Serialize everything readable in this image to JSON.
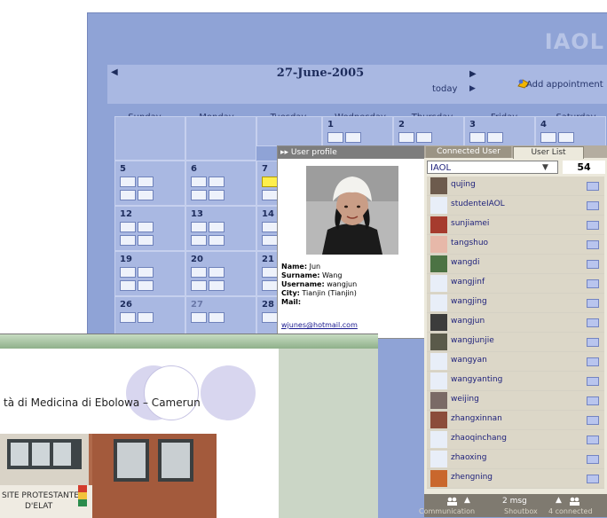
{
  "brand": "IAOL",
  "calendar": {
    "prev_label": "◀",
    "next_label": "▶",
    "title": "27-June-2005",
    "today_label": "today",
    "today_arrow": "▶",
    "add_label": "Add appointment",
    "days": [
      "Sunday",
      "Monday",
      "Tuesday",
      "Wednesday",
      "Thursday",
      "Friday",
      "Saturday"
    ],
    "week1": [
      "1",
      "2",
      "3",
      "4"
    ],
    "weeks_numbers": [
      [
        "5",
        "6",
        "7"
      ],
      [
        "12",
        "13",
        "14"
      ],
      [
        "19",
        "20",
        "21"
      ],
      [
        "26",
        "27",
        "28"
      ]
    ]
  },
  "profile": {
    "title_arrow": "▸▸",
    "title": "User profile",
    "name_label": "Name:",
    "name": "Jun",
    "surname_label": "Surname:",
    "surname": "Wang",
    "username_label": "Username:",
    "username": "wangjun",
    "city_label": "City:",
    "city": "Tianjin  (Tianjin)",
    "mail_label": "Mail:",
    "mail": "wjunes@hotmail.com"
  },
  "userlist": {
    "tab_connected": "Connected User",
    "tab_list": "User List",
    "group": "IAOL",
    "group_chevron": "▼",
    "count": "54",
    "users": [
      "qujing",
      "studenteIAOL",
      "sunjiamei",
      "tangshuo",
      "wangdi",
      "wangjinf",
      "wangjing",
      "wangjun",
      "wangjunjie",
      "wangyan",
      "wangyanting",
      "weijing",
      "zhangxinnan",
      "zhaoqinchang",
      "zhaoxing",
      "zhengning"
    ],
    "status": {
      "up_arrow": "▲",
      "msg": "2 msg",
      "communication": "Communication",
      "shoutbox": "Shoutbox",
      "connected": "4 connected"
    }
  },
  "slide": {
    "title": "tà di Medicina di Ebolowa – Camerun",
    "sign_text": "SITE PROTESTANTE",
    "sign_text2": "D'ELAT"
  },
  "colors": {
    "desktop": "#8fa3d6",
    "calendar_band": "#a9b8e2",
    "status_bar": "#7f7a70",
    "highlight_icon": "#ffef4d"
  }
}
